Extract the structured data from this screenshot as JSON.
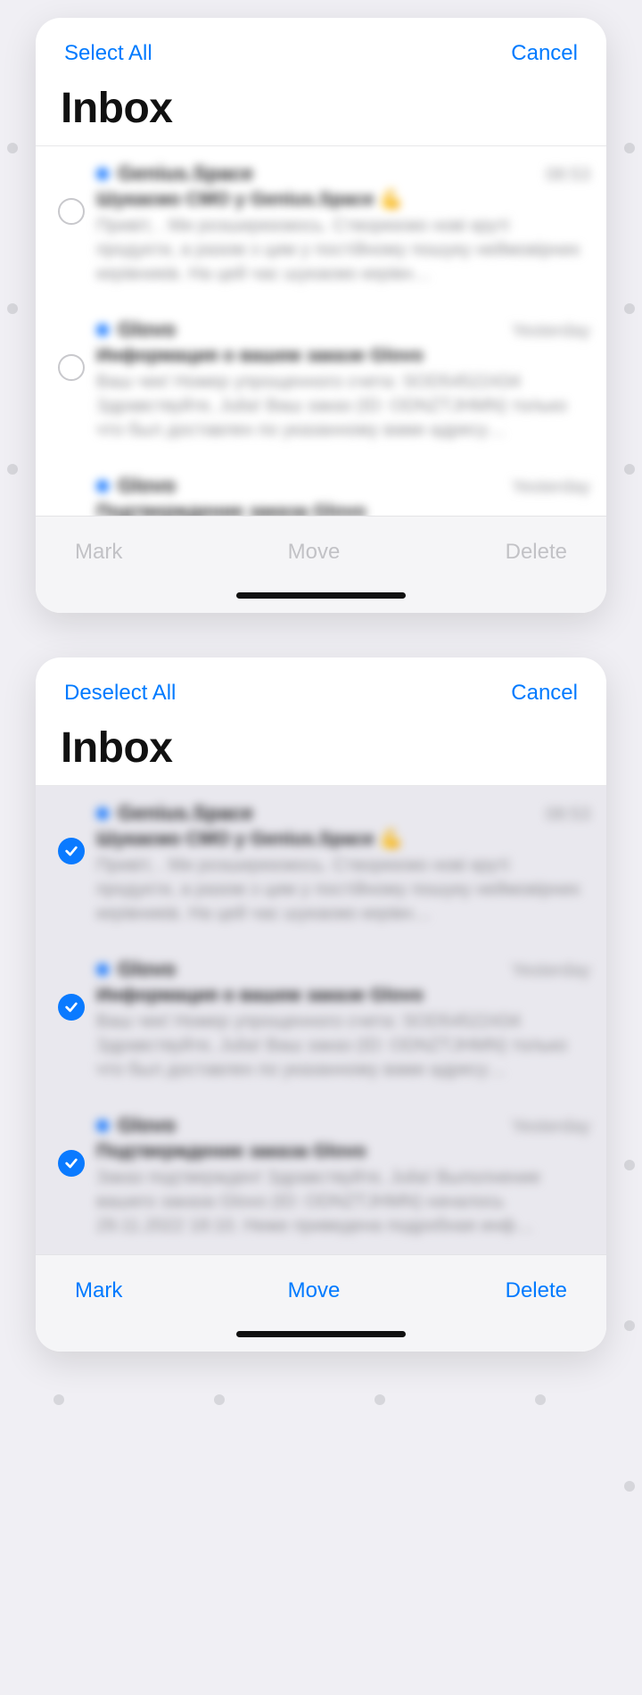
{
  "screen1": {
    "select_all": "Select All",
    "cancel": "Cancel",
    "title": "Inbox",
    "toolbar": {
      "mark": "Mark",
      "move": "Move",
      "delete": "Delete"
    },
    "rows": [
      {
        "sender": "Genius.Space",
        "time": "08:53",
        "subject": "Шукаємо CMO у Genius.Space 💪",
        "preview": "Привіт, . Ми розширюємось. Створюємо нові круті продукти, а разом з цим у постійному пошуку неймовірних керівників. На цей час шукаємо керівн…"
      },
      {
        "sender": "Glovo",
        "time": "Yesterday",
        "subject": "Информация о вашем заказе Glovo",
        "preview": "Ваш чек! Номер упрощенного счета: SOD54522434 Здравствуйте, Julia! Ваш заказ (ID: ODNZTJHMN) только что был доставлен по указанному вами адресу…"
      },
      {
        "sender": "Glovo",
        "time": "Yesterday",
        "subject": "Подтверждение заказа Glovo",
        "preview": ""
      }
    ]
  },
  "screen2": {
    "deselect_all": "Deselect All",
    "cancel": "Cancel",
    "title": "Inbox",
    "toolbar": {
      "mark": "Mark",
      "move": "Move",
      "delete": "Delete"
    },
    "rows": [
      {
        "sender": "Genius.Space",
        "time": "08:53",
        "subject": "Шукаємо CMO у Genius.Space 💪",
        "preview": "Привіт, . Ми розширюємось. Створюємо нові круті продукти, а разом з цим у постійному пошуку неймовірних керівників. На цей час шукаємо керівн…"
      },
      {
        "sender": "Glovo",
        "time": "Yesterday",
        "subject": "Информация о вашем заказе Glovo",
        "preview": "Ваш чек! Номер упрощенного счета: SOD54522434 Здравствуйте, Julia! Ваш заказ (ID: ODNZTJHMN) только что был доставлен по указанному вами адресу…"
      },
      {
        "sender": "Glovo",
        "time": "Yesterday",
        "subject": "Подтверждение заказа Glovo",
        "preview": "Заказ подтвержден! Здравствуйте, Julia! Выполнение вашего заказа Glovo (ID: ODNZTJHMN) началось 29.11.2022 18:10. Ниже приведена подробная инф…"
      }
    ]
  }
}
